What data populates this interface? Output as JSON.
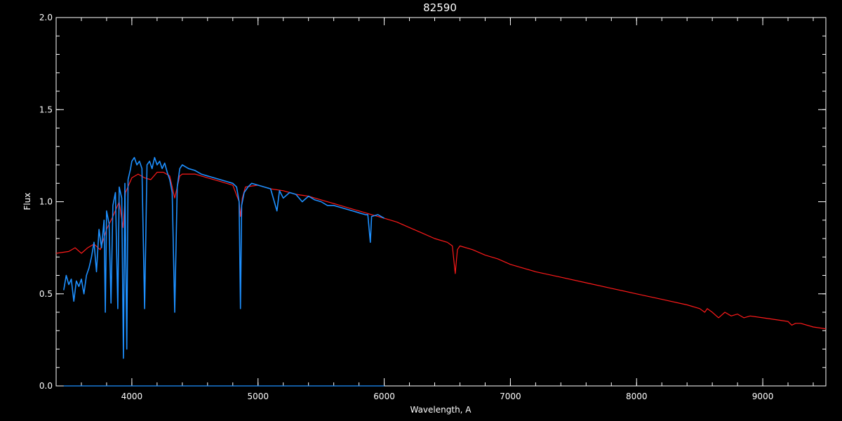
{
  "chart_data": {
    "type": "line",
    "title": "82590",
    "xlabel": "Wavelength, A",
    "ylabel": "Flux",
    "xlim": [
      3400,
      9500
    ],
    "ylim": [
      0.0,
      2.0
    ],
    "x_ticks": [
      4000,
      5000,
      6000,
      7000,
      8000,
      9000
    ],
    "x_tick_labels": [
      "4000",
      "5000",
      "6000",
      "7000",
      "8000",
      "9000"
    ],
    "x_minor_step": 200,
    "y_ticks": [
      0.0,
      0.5,
      1.0,
      1.5,
      2.0
    ],
    "y_tick_labels": [
      "0.0",
      "0.5",
      "1.0",
      "1.5",
      "2.0"
    ],
    "y_minor_step": 0.1,
    "grid": false,
    "background": "#000000",
    "axis_color": "#ffffff",
    "series": [
      {
        "color": "#ff1a1a",
        "points": [
          [
            3400,
            0.72
          ],
          [
            3500,
            0.73
          ],
          [
            3550,
            0.75
          ],
          [
            3600,
            0.72
          ],
          [
            3650,
            0.75
          ],
          [
            3700,
            0.77
          ],
          [
            3750,
            0.74
          ],
          [
            3800,
            0.85
          ],
          [
            3850,
            0.92
          ],
          [
            3900,
            1.0
          ],
          [
            3930,
            0.86
          ],
          [
            3950,
            1.05
          ],
          [
            4000,
            1.13
          ],
          [
            4050,
            1.15
          ],
          [
            4100,
            1.13
          ],
          [
            4150,
            1.12
          ],
          [
            4200,
            1.16
          ],
          [
            4250,
            1.16
          ],
          [
            4300,
            1.14
          ],
          [
            4340,
            1.02
          ],
          [
            4380,
            1.14
          ],
          [
            4400,
            1.15
          ],
          [
            4500,
            1.15
          ],
          [
            4600,
            1.13
          ],
          [
            4700,
            1.11
          ],
          [
            4800,
            1.09
          ],
          [
            4850,
            1.0
          ],
          [
            4861,
            0.92
          ],
          [
            4875,
            1.02
          ],
          [
            4900,
            1.08
          ],
          [
            5000,
            1.09
          ],
          [
            5100,
            1.07
          ],
          [
            5200,
            1.06
          ],
          [
            5300,
            1.04
          ],
          [
            5400,
            1.03
          ],
          [
            5500,
            1.01
          ],
          [
            5600,
            0.99
          ],
          [
            5700,
            0.97
          ],
          [
            5800,
            0.95
          ],
          [
            5900,
            0.93
          ],
          [
            6000,
            0.91
          ],
          [
            6100,
            0.89
          ],
          [
            6200,
            0.86
          ],
          [
            6300,
            0.83
          ],
          [
            6400,
            0.8
          ],
          [
            6500,
            0.78
          ],
          [
            6540,
            0.76
          ],
          [
            6563,
            0.61
          ],
          [
            6580,
            0.74
          ],
          [
            6600,
            0.76
          ],
          [
            6700,
            0.74
          ],
          [
            6800,
            0.71
          ],
          [
            6900,
            0.69
          ],
          [
            7000,
            0.66
          ],
          [
            7200,
            0.62
          ],
          [
            7400,
            0.59
          ],
          [
            7600,
            0.56
          ],
          [
            7800,
            0.53
          ],
          [
            8000,
            0.5
          ],
          [
            8200,
            0.47
          ],
          [
            8400,
            0.44
          ],
          [
            8500,
            0.42
          ],
          [
            8540,
            0.4
          ],
          [
            8560,
            0.42
          ],
          [
            8600,
            0.4
          ],
          [
            8650,
            0.37
          ],
          [
            8700,
            0.4
          ],
          [
            8750,
            0.38
          ],
          [
            8800,
            0.39
          ],
          [
            8850,
            0.37
          ],
          [
            8900,
            0.38
          ],
          [
            9000,
            0.37
          ],
          [
            9100,
            0.36
          ],
          [
            9200,
            0.35
          ],
          [
            9230,
            0.33
          ],
          [
            9260,
            0.34
          ],
          [
            9300,
            0.34
          ],
          [
            9400,
            0.32
          ],
          [
            9500,
            0.31
          ]
        ]
      },
      {
        "color": "#1e90ff",
        "points": [
          [
            3460,
            0.52
          ],
          [
            3480,
            0.6
          ],
          [
            3500,
            0.55
          ],
          [
            3520,
            0.58
          ],
          [
            3540,
            0.46
          ],
          [
            3560,
            0.57
          ],
          [
            3580,
            0.54
          ],
          [
            3600,
            0.58
          ],
          [
            3620,
            0.5
          ],
          [
            3640,
            0.6
          ],
          [
            3660,
            0.64
          ],
          [
            3680,
            0.7
          ],
          [
            3700,
            0.78
          ],
          [
            3720,
            0.62
          ],
          [
            3740,
            0.85
          ],
          [
            3760,
            0.75
          ],
          [
            3780,
            0.9
          ],
          [
            3790,
            0.4
          ],
          [
            3800,
            0.95
          ],
          [
            3820,
            0.88
          ],
          [
            3835,
            0.45
          ],
          [
            3850,
            0.98
          ],
          [
            3870,
            1.05
          ],
          [
            3889,
            0.42
          ],
          [
            3900,
            1.08
          ],
          [
            3920,
            1.02
          ],
          [
            3933,
            0.15
          ],
          [
            3945,
            1.1
          ],
          [
            3960,
            0.2
          ],
          [
            3970,
            1.12
          ],
          [
            3990,
            1.18
          ],
          [
            4000,
            1.22
          ],
          [
            4020,
            1.24
          ],
          [
            4040,
            1.2
          ],
          [
            4060,
            1.22
          ],
          [
            4080,
            1.18
          ],
          [
            4101,
            0.42
          ],
          [
            4120,
            1.2
          ],
          [
            4140,
            1.22
          ],
          [
            4160,
            1.18
          ],
          [
            4180,
            1.24
          ],
          [
            4200,
            1.2
          ],
          [
            4220,
            1.22
          ],
          [
            4240,
            1.18
          ],
          [
            4260,
            1.21
          ],
          [
            4280,
            1.16
          ],
          [
            4300,
            1.12
          ],
          [
            4320,
            1.05
          ],
          [
            4340,
            0.4
          ],
          [
            4360,
            1.08
          ],
          [
            4380,
            1.18
          ],
          [
            4400,
            1.2
          ],
          [
            4450,
            1.18
          ],
          [
            4500,
            1.17
          ],
          [
            4550,
            1.15
          ],
          [
            4600,
            1.14
          ],
          [
            4650,
            1.13
          ],
          [
            4700,
            1.12
          ],
          [
            4750,
            1.11
          ],
          [
            4800,
            1.1
          ],
          [
            4830,
            1.08
          ],
          [
            4850,
            1.0
          ],
          [
            4861,
            0.42
          ],
          [
            4870,
            0.98
          ],
          [
            4890,
            1.05
          ],
          [
            4920,
            1.08
          ],
          [
            4950,
            1.1
          ],
          [
            5000,
            1.09
          ],
          [
            5050,
            1.08
          ],
          [
            5100,
            1.07
          ],
          [
            5150,
            0.95
          ],
          [
            5170,
            1.06
          ],
          [
            5200,
            1.02
          ],
          [
            5250,
            1.05
          ],
          [
            5300,
            1.04
          ],
          [
            5350,
            1.0
          ],
          [
            5400,
            1.03
          ],
          [
            5450,
            1.01
          ],
          [
            5500,
            1.0
          ],
          [
            5550,
            0.98
          ],
          [
            5600,
            0.98
          ],
          [
            5650,
            0.97
          ],
          [
            5700,
            0.96
          ],
          [
            5750,
            0.95
          ],
          [
            5800,
            0.94
          ],
          [
            5850,
            0.93
          ],
          [
            5870,
            0.93
          ],
          [
            5890,
            0.78
          ],
          [
            5900,
            0.92
          ],
          [
            5950,
            0.93
          ],
          [
            6000,
            0.91
          ]
        ]
      },
      {
        "color": "#1e90ff",
        "points": [
          [
            3460,
            0.0
          ],
          [
            6000,
            0.0
          ]
        ]
      }
    ]
  }
}
